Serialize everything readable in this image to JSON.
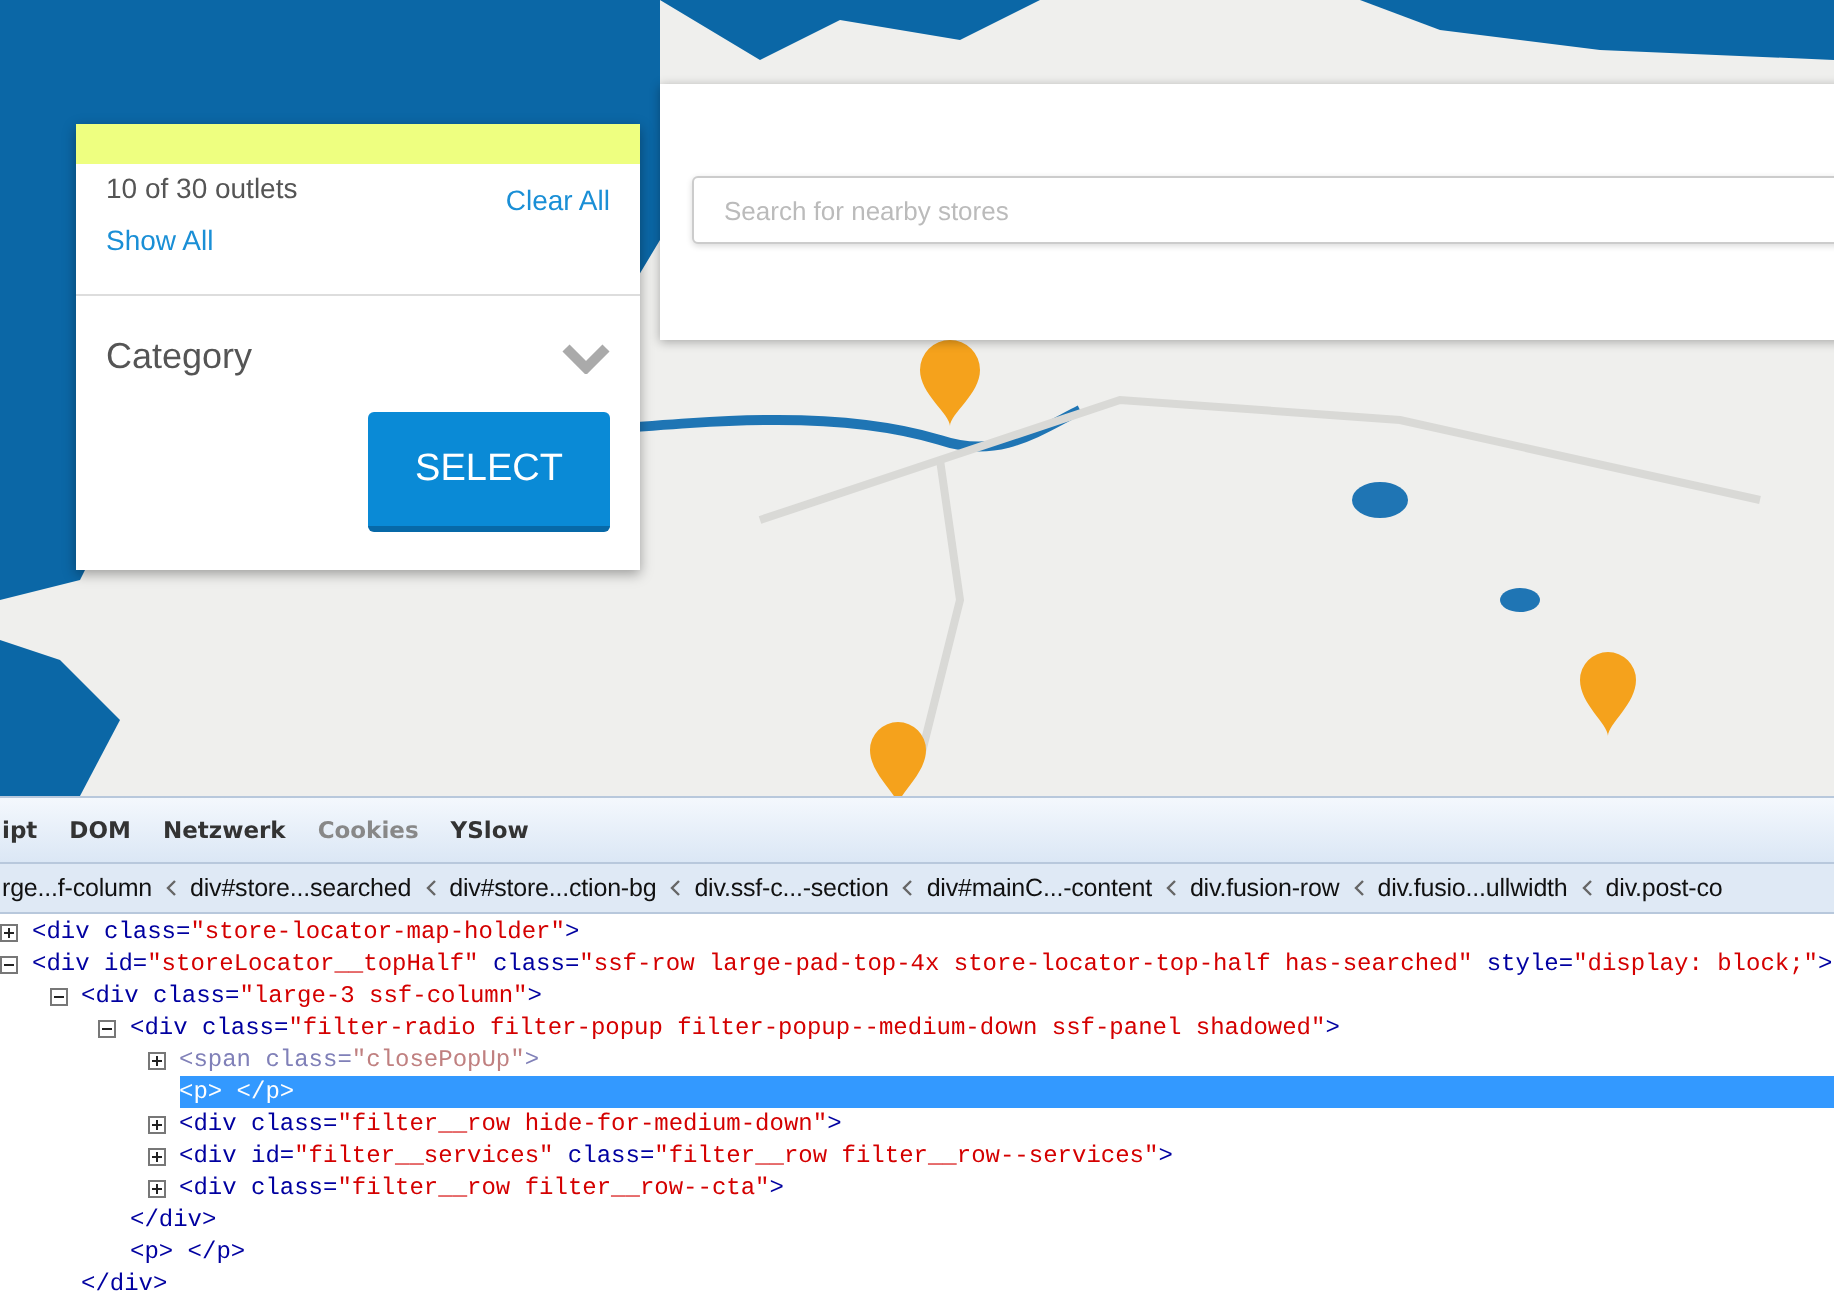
{
  "filter_panel": {
    "outlet_count": "10 of 30 outlets",
    "clear_all": "Clear All",
    "show_all": "Show All",
    "category": {
      "label": "Category",
      "expanded": false
    },
    "select_button": "SELECT"
  },
  "search": {
    "placeholder": "Search for nearby stores"
  },
  "devtools": {
    "tabs": [
      {
        "label": "ipt",
        "disabled": false
      },
      {
        "label": "DOM",
        "disabled": false
      },
      {
        "label": "Netzwerk",
        "disabled": false
      },
      {
        "label": "Cookies",
        "disabled": true
      },
      {
        "label": "YSlow",
        "disabled": false
      }
    ],
    "breadcrumbs": [
      "rge...f-column",
      "div#store...searched",
      "div#store...ction-bg",
      "div.ssf-c...-section",
      "div#mainC...-content",
      "div.fusion-row",
      "div.fusio...ullwidth",
      "div.post-co"
    ],
    "dom_tree": [
      {
        "expanded": false,
        "selected": false,
        "segments": [
          {
            "kind": "tag",
            "text": "<div class="
          },
          {
            "kind": "value",
            "text": "\"store-locator-map-holder\""
          },
          {
            "kind": "tag",
            "text": ">"
          }
        ]
      },
      {
        "expanded": true,
        "selected": false,
        "segments": [
          {
            "kind": "tag",
            "text": "<div id="
          },
          {
            "kind": "value",
            "text": "\"storeLocator__topHalf\""
          },
          {
            "kind": "tag",
            "text": " class="
          },
          {
            "kind": "value",
            "text": "\"ssf-row large-pad-top-4x store-locator-top-half has-searched\""
          },
          {
            "kind": "tag",
            "text": " style="
          },
          {
            "kind": "value",
            "text": "\"display: block;\""
          },
          {
            "kind": "tag",
            "text": ">"
          }
        ],
        "children": [
          {
            "expanded": true,
            "selected": false,
            "segments": [
              {
                "kind": "tag",
                "text": "<div class="
              },
              {
                "kind": "value",
                "text": "\"large-3 ssf-column\""
              },
              {
                "kind": "tag",
                "text": ">"
              }
            ],
            "children": [
              {
                "expanded": true,
                "selected": false,
                "segments": [
                  {
                    "kind": "tag",
                    "text": "<div class="
                  },
                  {
                    "kind": "value",
                    "text": "\"filter-radio filter-popup filter-popup--medium-down ssf-panel shadowed\""
                  },
                  {
                    "kind": "tag",
                    "text": ">"
                  }
                ],
                "children": [
                  {
                    "expanded": false,
                    "selected": false,
                    "segments": [
                      {
                        "kind": "dimtag",
                        "text": "<span class="
                      },
                      {
                        "kind": "dimvalue",
                        "text": "\"closePopUp\""
                      },
                      {
                        "kind": "dimtag",
                        "text": ">"
                      }
                    ]
                  },
                  {
                    "selected": true,
                    "segments": [
                      {
                        "kind": "tag",
                        "text": "<p> </p>"
                      }
                    ]
                  },
                  {
                    "expanded": false,
                    "selected": false,
                    "segments": [
                      {
                        "kind": "tag",
                        "text": "<div class="
                      },
                      {
                        "kind": "value",
                        "text": "\"filter__row hide-for-medium-down\""
                      },
                      {
                        "kind": "tag",
                        "text": ">"
                      }
                    ]
                  },
                  {
                    "expanded": false,
                    "selected": false,
                    "segments": [
                      {
                        "kind": "tag",
                        "text": "<div id="
                      },
                      {
                        "kind": "value",
                        "text": "\"filter__services\""
                      },
                      {
                        "kind": "tag",
                        "text": " class="
                      },
                      {
                        "kind": "value",
                        "text": "\"filter__row filter__row--services\""
                      },
                      {
                        "kind": "tag",
                        "text": ">"
                      }
                    ]
                  },
                  {
                    "expanded": false,
                    "selected": false,
                    "segments": [
                      {
                        "kind": "tag",
                        "text": "<div class="
                      },
                      {
                        "kind": "value",
                        "text": "\"filter__row filter__row--cta\""
                      },
                      {
                        "kind": "tag",
                        "text": ">"
                      }
                    ]
                  }
                ],
                "closing": [
                  {
                    "kind": "tag",
                    "text": "</div>"
                  }
                ]
              },
              {
                "selected": false,
                "segments": [
                  {
                    "kind": "tag",
                    "text": "<p> </p>"
                  }
                ]
              }
            ],
            "closing": [
              {
                "kind": "tag",
                "text": "</div>"
              }
            ]
          }
        ]
      }
    ]
  }
}
